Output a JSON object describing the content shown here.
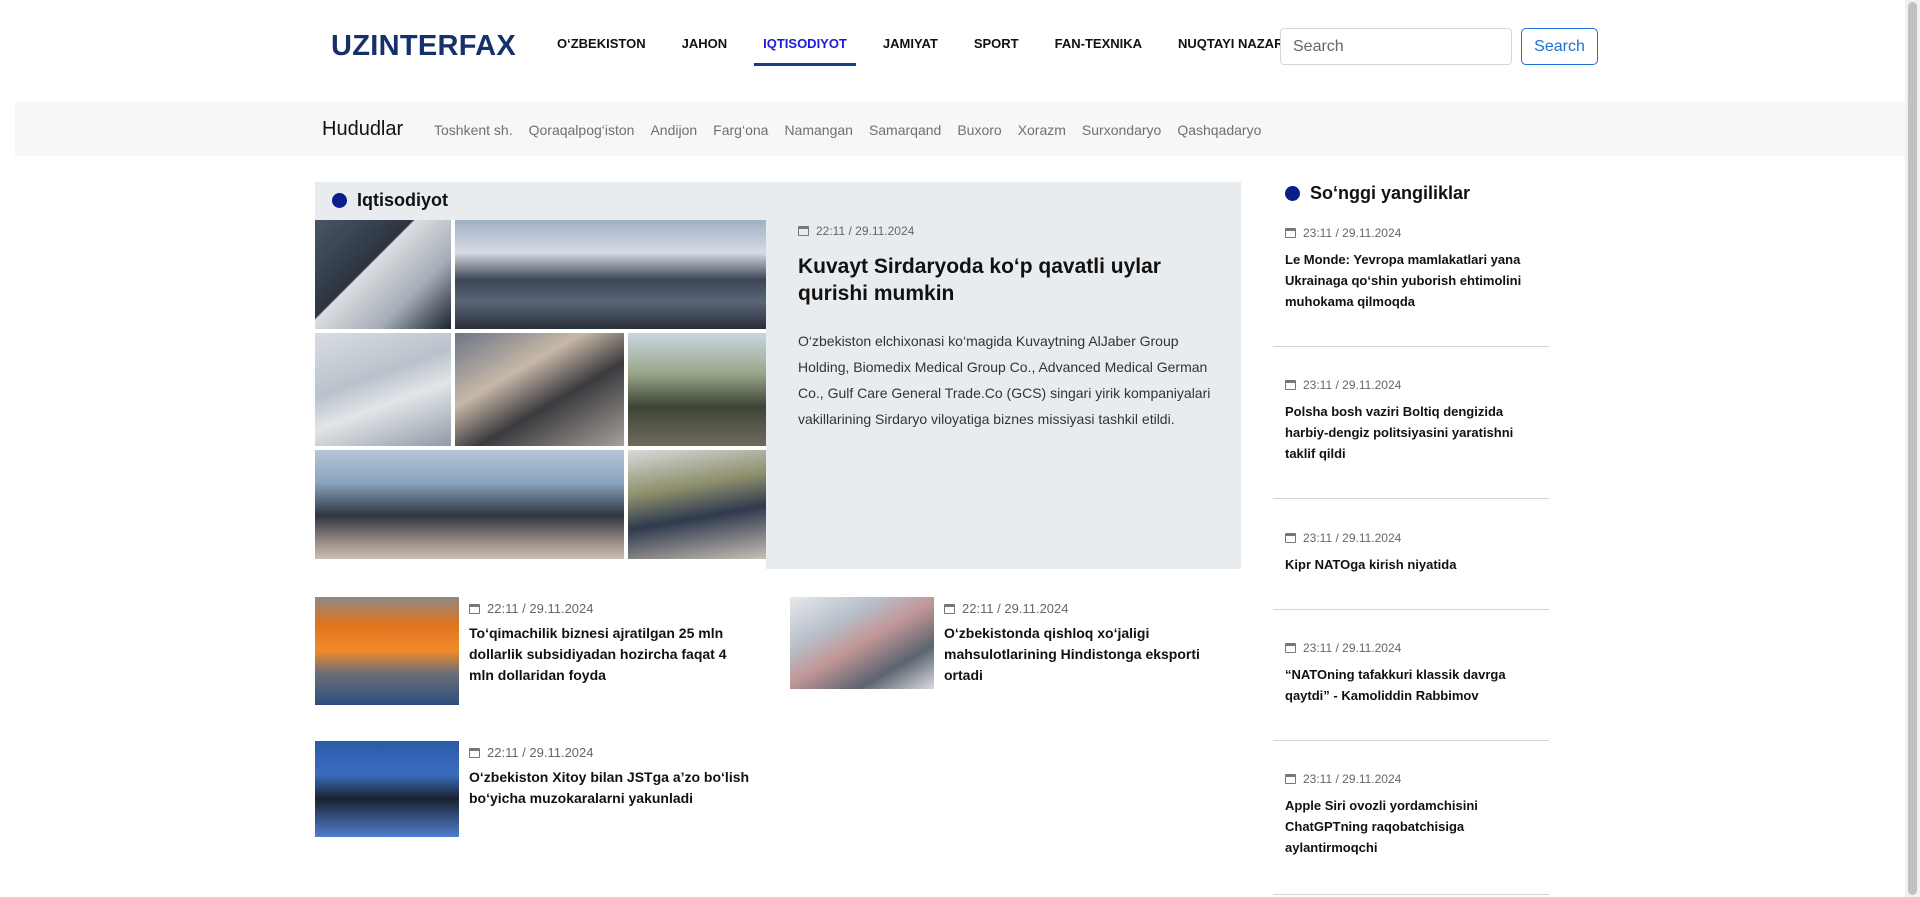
{
  "header": {
    "logo": "UZINTERFAX",
    "nav": [
      "O‘ZBEKISTON",
      "JAHON",
      "IQTISODIYOT",
      "JAMIYAT",
      "SPORT",
      "FAN-TEXNIKA",
      "NUQTAYI NAZAR"
    ],
    "active_nav": "IQTISODIYOT",
    "search_placeholder": "Search",
    "search_button": "Search"
  },
  "regions": {
    "title": "Hududlar",
    "items": [
      "Toshkent sh.",
      "Qoraqalpog‘iston",
      "Andijon",
      "Farg‘ona",
      "Namangan",
      "Samarqand",
      "Buxoro",
      "Xorazm",
      "Surxondaryo",
      "Qashqadaryo"
    ]
  },
  "section": {
    "title": "Iqtisodiyot",
    "featured": {
      "date": "22:11 / 29.11.2024",
      "title": "Kuvayt Sirdaryoda ko‘p qavatli uylar qurishi mumkin",
      "text": "O‘zbekiston elchixonasi ko‘magida Kuvaytning AlJaber Group Holding, Biomedix Medical Group Co., Advanced Medical German Co., Gulf Care General Trade.Co (GCS) singari yirik kompaniyalari vakillarining Sirdaryo viloyatiga biznes missiyasi tashkil etildi."
    },
    "news": [
      {
        "date": "22:11 / 29.11.2024",
        "title": "To‘qimachilik biznesi ajratilgan 25 mln dollarlik subsidiyadan hozircha faqat 4 mln dollaridan foyda"
      },
      {
        "date": "22:11 / 29.11.2024",
        "title": "O‘zbekistonda qishloq xo‘jaligi mahsulotlarining Hindistonga eksporti ortadi"
      },
      {
        "date": "22:11 / 29.11.2024",
        "title": "O‘zbekiston Xitoy bilan JSTga a’zo bo‘lish bo‘yicha muzokaralarni yakunladi"
      }
    ]
  },
  "sidebar": {
    "title": "So‘nggi yangiliklar",
    "items": [
      {
        "date": "23:11 / 29.11.2024",
        "title": "Le Monde: Yevropa mamlakatlari yana Ukrainaga qo‘shin yuborish ehtimolini muhokama qilmoqda"
      },
      {
        "date": "23:11 / 29.11.2024",
        "title": "Polsha bosh vaziri Boltiq dengizida harbiy-dengiz politsiyasini yaratishni taklif qildi"
      },
      {
        "date": "23:11 / 29.11.2024",
        "title": "Kipr NATOga kirish niyatida"
      },
      {
        "date": "23:11 / 29.11.2024",
        "title": "“NATOning tafakkuri klassik davrga qaytdi” - Kamoliddin Rabbimov"
      },
      {
        "date": "23:11 / 29.11.2024",
        "title": "Apple Siri ovozli yordamchisini ChatGPTning raqobatchisiga aylantirmoqchi"
      }
    ]
  },
  "colors": {
    "logo": "#15306b",
    "accent_dot": "#0b1f8a",
    "active_nav": "#1a1ae0",
    "search_button": "#1f6fd6",
    "featured_bg": "#e9ecef",
    "regions_bg": "#f6f7f8"
  },
  "icons": [
    "calendar-icon"
  ]
}
